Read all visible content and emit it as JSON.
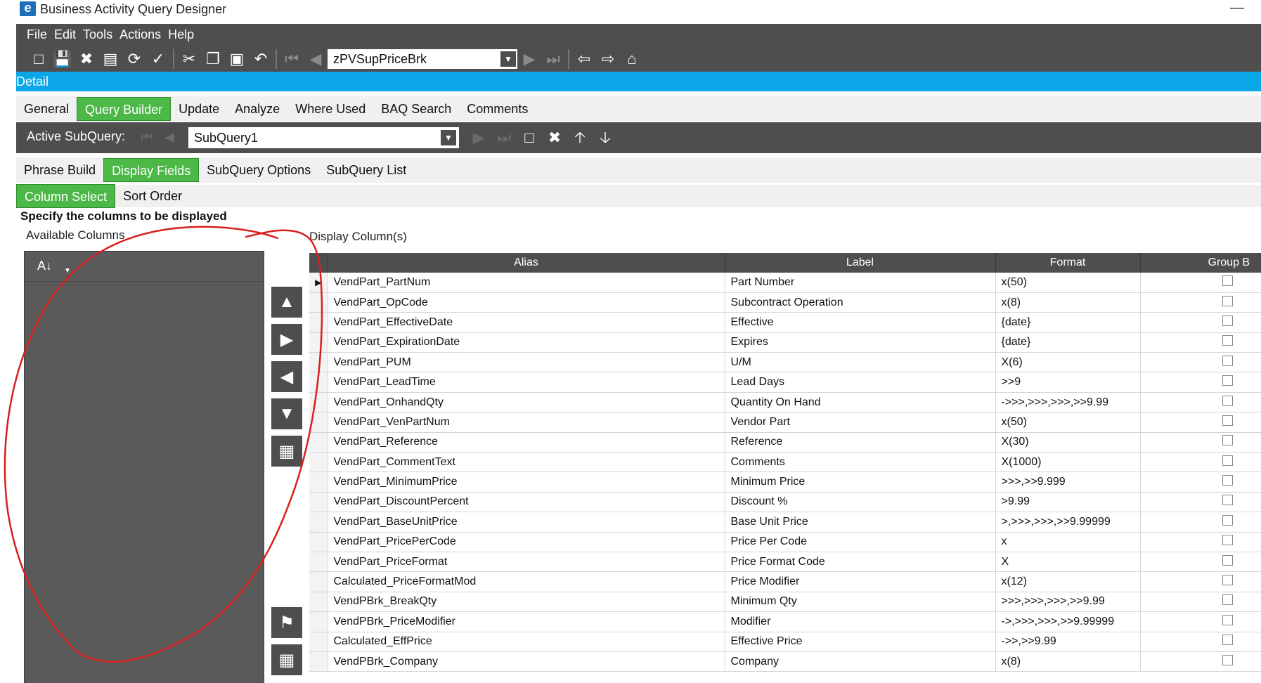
{
  "window": {
    "title": "Business Activity Query Designer",
    "minimize": "—",
    "app_icon": "e"
  },
  "menu": [
    "File",
    "Edit",
    "Tools",
    "Actions",
    "Help"
  ],
  "toolbar": {
    "query_value": "zPVSupPriceBrk"
  },
  "detail_bar": {
    "label": "Detail"
  },
  "main_tabs": [
    "General",
    "Query Builder",
    "Update",
    "Analyze",
    "Where Used",
    "BAQ Search",
    "Comments"
  ],
  "main_tabs_active": "Query Builder",
  "subquery": {
    "label": "Active SubQuery:",
    "value": "SubQuery1"
  },
  "sub_tabs": [
    "Phrase Build",
    "Display Fields",
    "SubQuery Options",
    "SubQuery List"
  ],
  "sub_tabs_active": "Display Fields",
  "column_tabs": [
    "Column Select",
    "Sort Order"
  ],
  "column_tabs_active": "Column Select",
  "instructions": "Specify the columns to be displayed",
  "available_label": "Available Columns",
  "display_label": "Display Column(s)",
  "grid": {
    "headers": [
      "Alias",
      "Label",
      "Format",
      "Group B"
    ],
    "rows": [
      [
        "VendPart_PartNum",
        "Part Number",
        "x(50)"
      ],
      [
        "VendPart_OpCode",
        "Subcontract Operation",
        "x(8)"
      ],
      [
        "VendPart_EffectiveDate",
        "Effective",
        "{date}"
      ],
      [
        "VendPart_ExpirationDate",
        "Expires",
        "{date}"
      ],
      [
        "VendPart_PUM",
        "U/M",
        "X(6)"
      ],
      [
        "VendPart_LeadTime",
        "Lead Days",
        ">>9"
      ],
      [
        "VendPart_OnhandQty",
        "Quantity On Hand",
        "->>>,>>>,>>>,>>9.99"
      ],
      [
        "VendPart_VenPartNum",
        "Vendor Part",
        "x(50)"
      ],
      [
        "VendPart_Reference",
        "Reference",
        "X(30)"
      ],
      [
        "VendPart_CommentText",
        "Comments",
        "X(1000)"
      ],
      [
        "VendPart_MinimumPrice",
        "Minimum Price",
        ">>>,>>9.999"
      ],
      [
        "VendPart_DiscountPercent",
        "Discount %",
        ">9.99"
      ],
      [
        "VendPart_BaseUnitPrice",
        "Base Unit Price",
        ">,>>>,>>>,>>9.99999"
      ],
      [
        "VendPart_PricePerCode",
        "Price Per Code",
        "x"
      ],
      [
        "VendPart_PriceFormat",
        "Price Format Code",
        "X"
      ],
      [
        "Calculated_PriceFormatMod",
        "Price Modifier",
        "x(12)"
      ],
      [
        "VendPBrk_BreakQty",
        "Minimum Qty",
        ">>>,>>>,>>>,>>9.99"
      ],
      [
        "VendPBrk_PriceModifier",
        "Modifier",
        "->,>>>,>>>,>>9.99999"
      ],
      [
        "Calculated_EffPrice",
        "Effective Price",
        "->>,>>9.99"
      ],
      [
        "VendPBrk_Company",
        "Company",
        "x(8)"
      ]
    ]
  },
  "colors": {
    "accent_green": "#4cb848",
    "detail_blue": "#0aa6e8",
    "dark_bar": "#4e4e4e",
    "annotation_red": "#d8201e"
  }
}
